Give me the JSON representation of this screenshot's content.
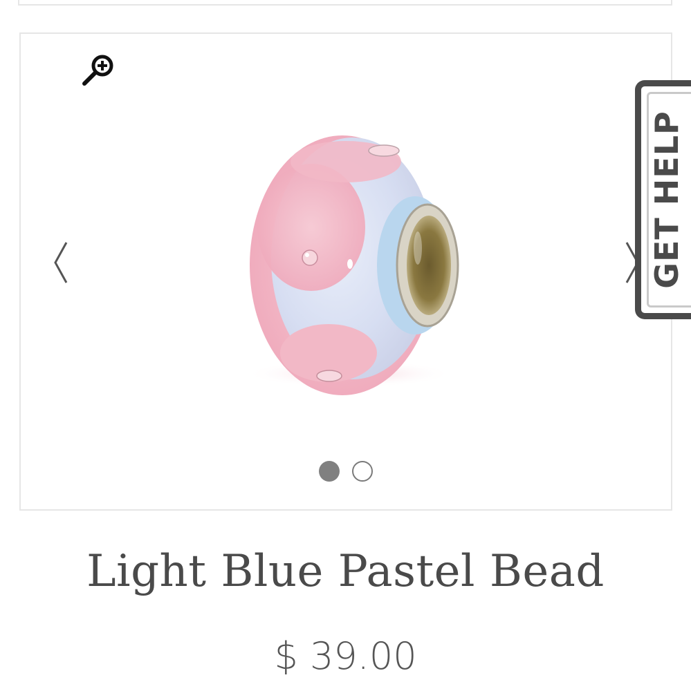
{
  "product": {
    "title": "Light Blue Pastel Bead",
    "price": "$ 39.00"
  },
  "gallery": {
    "image_alt": "Light Blue Pastel Bead",
    "slides_total": 2,
    "active_slide": 1,
    "zoom_icon": "zoom-in-icon",
    "prev_icon": "chevron-left-icon",
    "next_icon": "chevron-right-icon"
  },
  "help_tab": {
    "label": "GET HELP"
  },
  "colors": {
    "text": "#4a4a4a",
    "price": "#555555",
    "border": "#e6e6e6",
    "dot_active": "#808080",
    "bead_pink": "#f2b8c6",
    "bead_blue": "#cfe3f2"
  }
}
